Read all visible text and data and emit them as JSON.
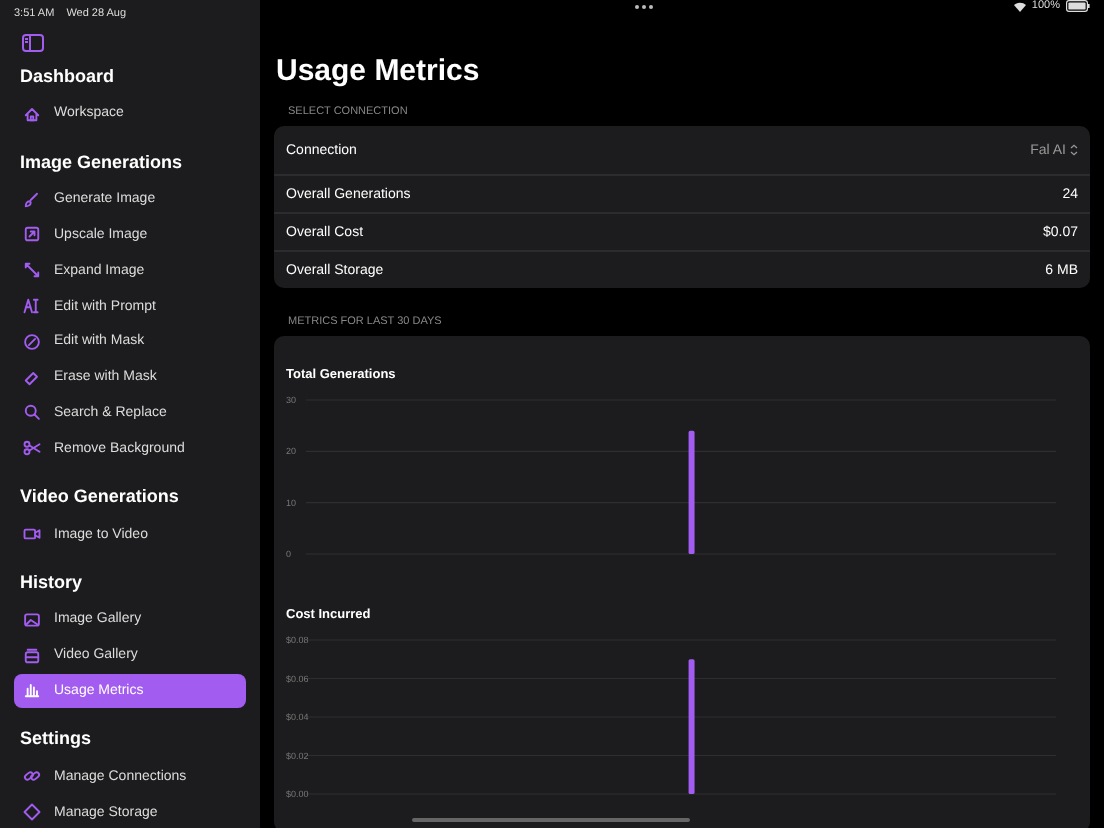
{
  "status_bar": {
    "time": "3:51 AM",
    "date": "Wed 28 Aug",
    "battery": "100%"
  },
  "sidebar": {
    "sections": [
      {
        "title": "Dashboard",
        "items": [
          {
            "label": "Workspace",
            "selected": false
          }
        ]
      },
      {
        "title": "Image Generations",
        "items": [
          {
            "label": "Generate Image",
            "selected": false
          },
          {
            "label": "Upscale Image",
            "selected": false
          },
          {
            "label": "Expand Image",
            "selected": false
          },
          {
            "label": "Edit with Prompt",
            "selected": false
          },
          {
            "label": "Edit with Mask",
            "selected": false
          },
          {
            "label": "Erase with Mask",
            "selected": false
          },
          {
            "label": "Search & Replace",
            "selected": false
          },
          {
            "label": "Remove Background",
            "selected": false
          }
        ]
      },
      {
        "title": "Video Generations",
        "items": [
          {
            "label": "Image to Video",
            "selected": false
          }
        ]
      },
      {
        "title": "History",
        "items": [
          {
            "label": "Image Gallery",
            "selected": false
          },
          {
            "label": "Video Gallery",
            "selected": false
          },
          {
            "label": "Usage Metrics",
            "selected": true
          }
        ]
      },
      {
        "title": "Settings",
        "items": [
          {
            "label": "Manage Connections",
            "selected": false
          },
          {
            "label": "Manage Storage",
            "selected": false
          }
        ]
      }
    ]
  },
  "main": {
    "title": "Usage Metrics",
    "connection_section": {
      "header": "SELECT CONNECTION",
      "picker": {
        "label": "Connection",
        "value": "Fal AI"
      },
      "rows": [
        {
          "label": "Overall Generations",
          "value": "24"
        },
        {
          "label": "Overall Cost",
          "value": "$0.07"
        },
        {
          "label": "Overall Storage",
          "value": "6 MB"
        }
      ]
    },
    "metrics_section": {
      "header": "METRICS FOR LAST 30 DAYS",
      "charts": [
        {
          "chart_data": {
            "type": "bar",
            "grid": true,
            "title": "Total Generations",
            "values": [
              null,
              null,
              null,
              null,
              null,
              null,
              null,
              null,
              null,
              null,
              null,
              null,
              null,
              null,
              null,
              24,
              null,
              null,
              null,
              null,
              null,
              null,
              null,
              null,
              null,
              null,
              null,
              null,
              null,
              null
            ],
            "ylim": [
              0,
              30
            ],
            "yticks": [
              0,
              10,
              20,
              30
            ]
          }
        },
        {
          "chart_data": {
            "type": "bar",
            "grid": true,
            "title": "Cost Incurred",
            "values": [
              null,
              null,
              null,
              null,
              null,
              null,
              null,
              null,
              null,
              null,
              null,
              null,
              null,
              null,
              null,
              0.07,
              null,
              null,
              null,
              null,
              null,
              null,
              null,
              null,
              null,
              null,
              null,
              null,
              null,
              null
            ],
            "ylim": [
              0,
              0.08
            ],
            "yticks": [
              {
                "value": 0,
                "label": "$0.00"
              },
              {
                "value": 0.02,
                "label": "$0.02"
              },
              {
                "value": 0.04,
                "label": "$0.04"
              },
              {
                "value": 0.06,
                "label": "$0.06"
              },
              {
                "value": 0.08,
                "label": "$0.08"
              }
            ]
          }
        }
      ]
    }
  }
}
